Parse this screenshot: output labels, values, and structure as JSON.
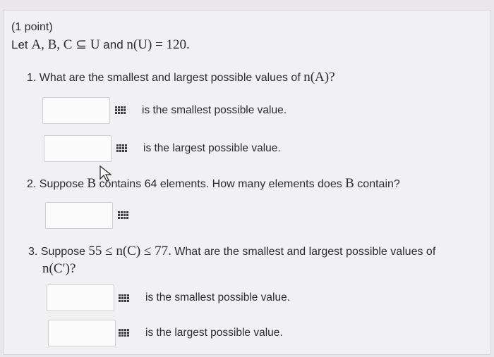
{
  "header": {
    "points": "(1 point)",
    "let_prefix": "Let ",
    "let_math": "A, B, C ⊆ U",
    "let_and": " and ",
    "let_math2": "n(U) = 120."
  },
  "q1": {
    "number": "1.",
    "text": "What are the smallest and largest possible values of ",
    "math": "n(A)?",
    "answer_smallest": {
      "value": "",
      "label": "is the smallest possible value."
    },
    "answer_largest": {
      "value": "",
      "label": "is the largest possible value."
    }
  },
  "q2": {
    "number": "2.",
    "text_before": "Suppose ",
    "math_b": "B",
    "text_mid": "contains 64 elements. How many elements does ",
    "math_b2": "B",
    "text_after": " contain?",
    "answer": {
      "value": ""
    }
  },
  "q3": {
    "number": "3.",
    "text_before": "Suppose ",
    "math_range": "55 ≤ n(C) ≤ 77.",
    "text_after": " What are the smallest and largest possible values of",
    "math_target": "n(C′)?",
    "answer_smallest": {
      "value": "",
      "label": "is the smallest possible value."
    },
    "answer_largest": {
      "value": "",
      "label": "is the largest possible value."
    }
  },
  "icons": {
    "grid": "matrix-grid-icon",
    "cursor": "mouse-pointer-icon"
  }
}
